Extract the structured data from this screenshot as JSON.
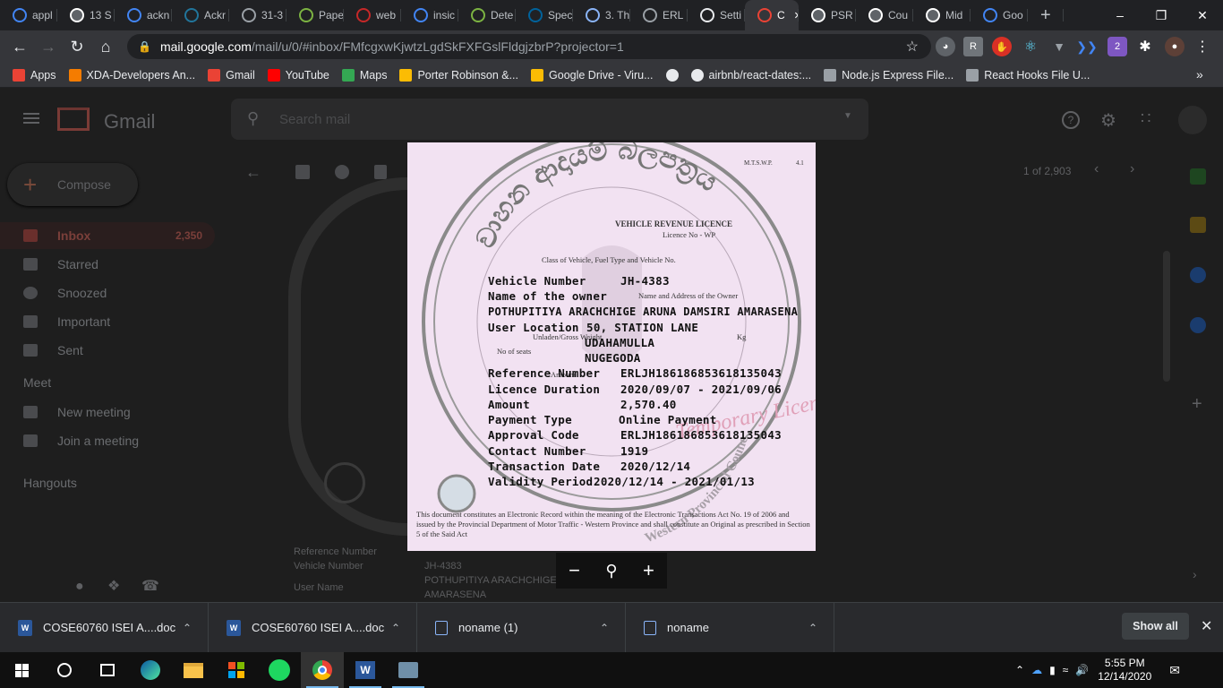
{
  "tabs": [
    {
      "label": "appl",
      "icon": "google-icon",
      "color": "#4285f4"
    },
    {
      "label": "13 S",
      "icon": "g-logo-icon",
      "color": "#ffffff"
    },
    {
      "label": "ackn",
      "icon": "google-icon",
      "color": "#4285f4"
    },
    {
      "label": "Ackr",
      "icon": "wordpress-icon",
      "color": "#21759b"
    },
    {
      "label": "31-3",
      "icon": "globe-icon",
      "color": "#9aa0a6"
    },
    {
      "label": "Pape",
      "icon": "smiley-icon",
      "color": "#7cb342"
    },
    {
      "label": "web",
      "icon": "target-icon",
      "color": "#c62828"
    },
    {
      "label": "insic",
      "icon": "google-icon",
      "color": "#4285f4"
    },
    {
      "label": "Dete",
      "icon": "smiley-icon",
      "color": "#7cb342"
    },
    {
      "label": "Spec",
      "icon": "ieee-icon",
      "color": "#00629b"
    },
    {
      "label": "3. Th",
      "icon": "cloud-icon",
      "color": "#8ab4f8"
    },
    {
      "label": "ERL",
      "icon": "globe-icon",
      "color": "#9aa0a6"
    },
    {
      "label": "Setti",
      "icon": "gear-icon",
      "color": "#e8eaed"
    },
    {
      "label": "C",
      "icon": "gmail-icon",
      "color": "#ea4335",
      "active": true
    },
    {
      "label": "PSR",
      "icon": "doc-icon",
      "color": "#ffffff"
    },
    {
      "label": "Cou",
      "icon": "doc-icon",
      "color": "#ffffff"
    },
    {
      "label": "Mid",
      "icon": "doc-icon",
      "color": "#ffffff"
    },
    {
      "label": "Goo",
      "icon": "google-icon",
      "color": "#4285f4"
    }
  ],
  "address": {
    "host": "mail.google.com",
    "path": "/mail/u/0/#inbox/FMfcgxwKjwtzLgdSkFXFGslFldgjzbrP?projector=1"
  },
  "bookmarks": [
    {
      "label": "Apps",
      "icon": "apps-grid-icon",
      "color": "#ea4335"
    },
    {
      "label": "XDA-Developers An...",
      "icon": "xda-icon",
      "color": "#f57c00"
    },
    {
      "label": "Gmail",
      "icon": "gmail-icon",
      "color": "#ea4335"
    },
    {
      "label": "YouTube",
      "icon": "youtube-icon",
      "color": "#ff0000"
    },
    {
      "label": "Maps",
      "icon": "maps-pin-icon",
      "color": "#34a853"
    },
    {
      "label": "Porter Robinson &...",
      "icon": "drive-icon",
      "color": "#fbbc04"
    },
    {
      "label": "Google Drive - Viru...",
      "icon": "drive-icon",
      "color": "#fbbc04"
    },
    {
      "label": "",
      "icon": "globe-icon",
      "color": "#e8eaed"
    },
    {
      "label": "airbnb/react-dates:...",
      "icon": "github-icon",
      "color": "#e8eaed"
    },
    {
      "label": "Node.js Express File...",
      "icon": "codesandbox-icon",
      "color": "#9aa0a6"
    },
    {
      "label": "React Hooks File U...",
      "icon": "codesandbox-icon",
      "color": "#9aa0a6"
    }
  ],
  "gmail": {
    "logo": "Gmail",
    "search_placeholder": "Search mail",
    "compose": "Compose",
    "counter": "1 of 2,903",
    "nav": [
      {
        "label": "Inbox",
        "count": "2,350"
      },
      {
        "label": "Starred"
      },
      {
        "label": "Snoozed"
      },
      {
        "label": "Important"
      },
      {
        "label": "Sent"
      }
    ],
    "meet_heading": "Meet",
    "meet": [
      "New meeting",
      "Join a meeting"
    ],
    "hangouts_heading": "Hangouts",
    "bg_labels": [
      "Reference Number",
      "Vehicle Number",
      "User Name"
    ],
    "bg_values": [
      "JH-4383",
      "POTHUPITIYA ARACHCHIGE ARUNA DAMSIRI",
      "AMARASENA"
    ]
  },
  "licence": {
    "rows": [
      {
        "label": "Vehicle Number",
        "value": "JH-4383"
      },
      {
        "label": "Name of the owner",
        "value": ""
      },
      {
        "label": "",
        "value": "POTHUPITIYA ARACHCHIGE ARUNA DAMSIRI AMARASENA"
      },
      {
        "label": "User Location",
        "value": "50, STATION LANE"
      },
      {
        "label": "",
        "value": "UDAHAMULLA"
      },
      {
        "label": "",
        "value": "NUGEGODA"
      },
      {
        "label": "Reference Number",
        "value": "ERLJH186186853618135043"
      },
      {
        "label": "Licence Duration",
        "value": "2020/09/07 - 2021/09/06"
      },
      {
        "label": "Amount",
        "value": "2,570.40"
      },
      {
        "label": "Payment Type",
        "value": "Online Payment"
      },
      {
        "label": "Approval Code",
        "value": "ERLJH186186853618135043"
      },
      {
        "label": "Contact Number",
        "value": "1919"
      },
      {
        "label": "Transaction Date",
        "value": "2020/12/14"
      },
      {
        "label": "Validity Period",
        "value": "2020/12/14 - 2021/01/13"
      }
    ],
    "header_en": "VEHICLE REVENUE LICENCE",
    "licence_no_label": "Licence No - WP",
    "class_line": "Class of Vehicle, Fuel Type and Vehicle No.",
    "owner_line": "Name and Address of the Owner",
    "unladen_line": "Unladen/Gross Weight",
    "unladen_unit": "Kg",
    "seats_line": "No of seats",
    "amount_line": "Amount",
    "corner": "M.T.S.W.P.",
    "corner_num": "4.1",
    "seal_bottom": "Western Provincial Council",
    "watermark": "Temporary Licence",
    "footer": "This document constitutes an Electronic Record within the meaning of the Electronic Transactions Act No. 19 of 2006 and issued by the Provincial Department of  Motor Traffic - Western Province and shall constitute an Original as prescribed in Section 5 of the Said Act"
  },
  "downloads": [
    {
      "name": "COSE60760 ISEI A....doc",
      "icon": "word-doc-icon"
    },
    {
      "name": "COSE60760 ISEI A....doc",
      "icon": "word-doc-icon"
    },
    {
      "name": "noname (1)",
      "icon": "file-icon"
    },
    {
      "name": "noname",
      "icon": "file-icon"
    }
  ],
  "show_all": "Show all",
  "clock": {
    "time": "5:55 PM",
    "date": "12/14/2020"
  },
  "colors": {
    "accent": "#8ab4f8",
    "licence_bg": "#f2e2f2",
    "seal": "#8a8a8a"
  }
}
